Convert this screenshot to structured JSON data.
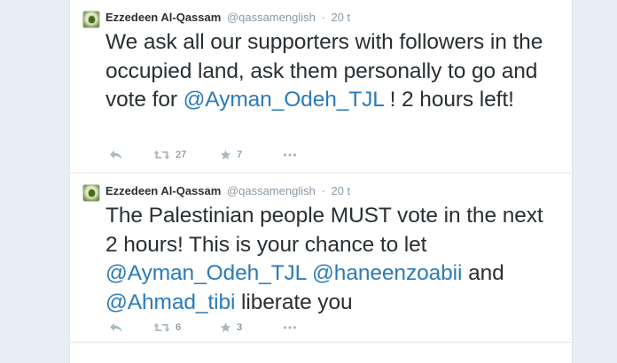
{
  "tweets": [
    {
      "author_name": "Ezzedeen Al-Qassam",
      "handle": "@qassamenglish",
      "separator": "·",
      "time": "20 t",
      "text_parts": [
        "We ask all our supporters with followers in the occupied land, ask them personally to go and vote for ",
        "@Ayman_Odeh_TJL",
        " ! 2 hours left!"
      ],
      "retweets": "27",
      "favorites": "7"
    },
    {
      "author_name": "Ezzedeen Al-Qassam",
      "handle": "@qassamenglish",
      "separator": "·",
      "time": "20 t",
      "text_parts": [
        "The Palestinian people MUST vote in the next 2 hours! This is your chance to let ",
        "@Ayman_Odeh_TJL",
        " ",
        "@haneenzoabii",
        " and ",
        "@Ahmad_tibi",
        " liberate you"
      ],
      "retweets": "6",
      "favorites": "3"
    }
  ],
  "icons": {
    "reply": "reply-icon",
    "retweet": "retweet-icon",
    "favorite": "star-icon",
    "more": "more-icon"
  },
  "colors": {
    "mention": "#2b7bb9",
    "text": "#292f33",
    "muted": "#8899a6",
    "background": "#e9eef2"
  }
}
